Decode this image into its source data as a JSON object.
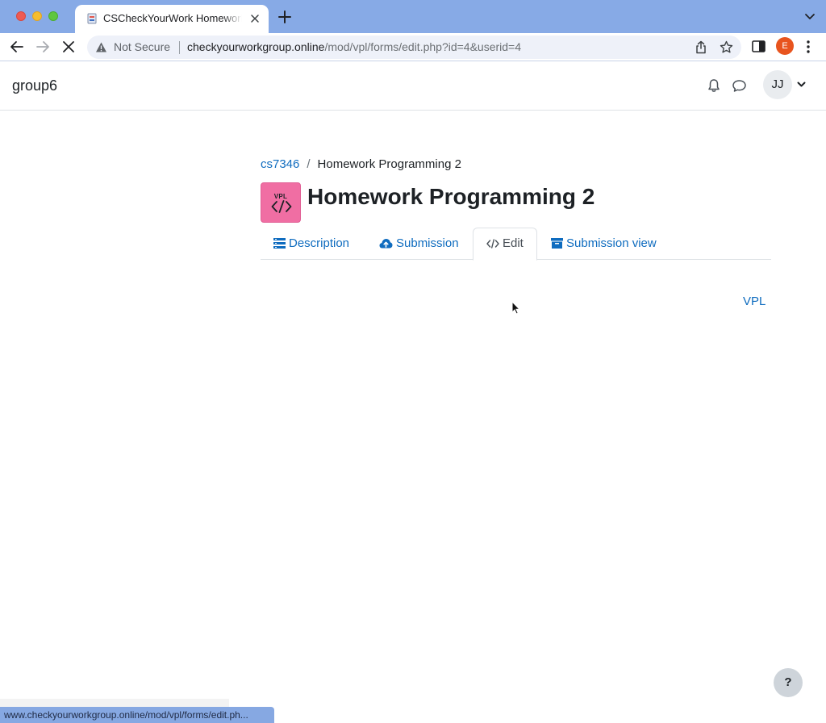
{
  "browser": {
    "tab_title": "CSCheckYourWork Homework",
    "security_label": "Not Secure",
    "url_host": "checkyourworkgroup.online",
    "url_path": "/mod/vpl/forms/edit.php?id=4&userid=4",
    "profile_initial": "E",
    "status_url": "www.checkyourworkgroup.online/mod/vpl/forms/edit.ph..."
  },
  "navbar": {
    "site_name": "group6",
    "user_initials": "JJ"
  },
  "breadcrumb": {
    "course": "cs7346",
    "separator": "/",
    "current": "Homework Programming 2"
  },
  "activity": {
    "icon_label": "VPL",
    "title": "Homework Programming 2"
  },
  "tabs": [
    {
      "label": "Description",
      "icon": "list-icon",
      "active": false
    },
    {
      "label": "Submission",
      "icon": "cloud-upload-icon",
      "active": false
    },
    {
      "label": "Edit",
      "icon": "code-icon",
      "active": true
    },
    {
      "label": "Submission view",
      "icon": "archive-icon",
      "active": false
    }
  ],
  "content": {
    "vpl_link": "VPL"
  },
  "help_button": "?",
  "colors": {
    "link": "#0f6cbf",
    "vpl_icon_bg": "#f06ea3",
    "chrome_tabstrip": "#87aae6"
  }
}
